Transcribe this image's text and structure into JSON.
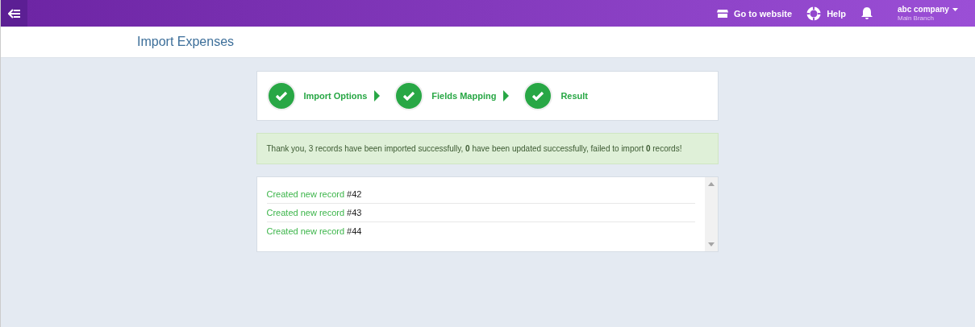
{
  "topbar": {
    "website_link": "Go to website",
    "help_link": "Help",
    "account": {
      "company": "abc company",
      "branch": "Main Branch"
    }
  },
  "page_title": "Import Expenses",
  "steps": [
    {
      "label": "Import Options",
      "done": true
    },
    {
      "label": "Fields Mapping",
      "done": true
    },
    {
      "label": "Result",
      "done": true
    }
  ],
  "message": "Thank you, 3 records have been imported successfully, **0** have been updated successfully, failed to import **0** records!",
  "records": [
    {
      "label": "Created new record",
      "number": "#42"
    },
    {
      "label": "Created new record",
      "number": "#43"
    },
    {
      "label": "Created new record",
      "number": "#44"
    }
  ]
}
